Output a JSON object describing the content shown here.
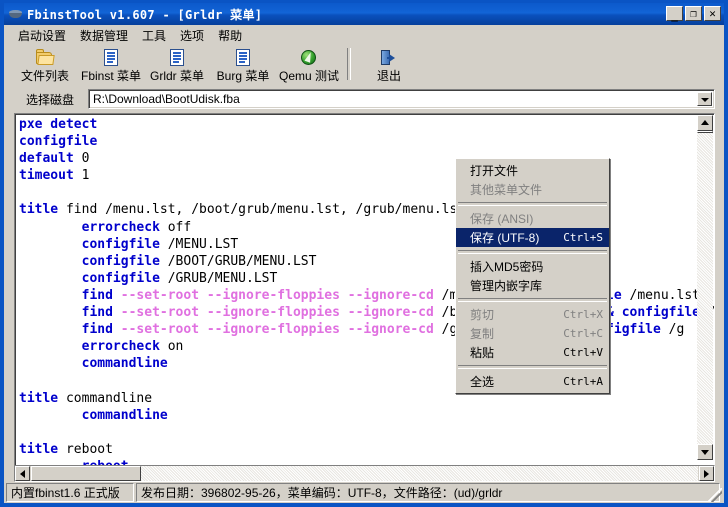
{
  "window": {
    "title": "FbinstTool v1.607 - [Grldr 菜单]",
    "icon": "disk-icon",
    "buttons": {
      "minimize": "_",
      "maximize": "❐",
      "close": "✕"
    },
    "accent": "#0a54c4"
  },
  "menubar": {
    "items": [
      {
        "label": "启动设置"
      },
      {
        "label": "数据管理"
      },
      {
        "label": "工具"
      },
      {
        "label": "选项"
      },
      {
        "label": "帮助"
      }
    ]
  },
  "toolbar": {
    "items": [
      {
        "label": "文件列表",
        "icon": "folder-icon"
      },
      {
        "label": "Fbinst 菜单",
        "icon": "document-list-icon"
      },
      {
        "label": "Grldr 菜单",
        "icon": "document-list-icon"
      },
      {
        "label": "Burg 菜单",
        "icon": "document-list-icon"
      },
      {
        "label": "Qemu 测试",
        "icon": "qemu-icon"
      },
      {
        "label": "退出",
        "icon": "exit-icon"
      }
    ]
  },
  "diskbar": {
    "label": "选择磁盘",
    "value": "R:\\Download\\BootUdisk.fba",
    "placeholder": "R:\\Download\\BootUdisk.fba"
  },
  "editor": {
    "lines": [
      [
        {
          "t": "pxe detect",
          "c": "kw"
        }
      ],
      [
        {
          "t": "configfile",
          "c": "kw"
        }
      ],
      [
        {
          "t": "default",
          "c": "kw"
        },
        {
          "t": " 0",
          "c": "pl"
        }
      ],
      [
        {
          "t": "timeout",
          "c": "kw"
        },
        {
          "t": " 1",
          "c": "pl"
        }
      ],
      [
        {
          "t": "",
          "c": "pl"
        }
      ],
      [
        {
          "t": "title",
          "c": "kw"
        },
        {
          "t": " find /menu.lst, /boot/grub/menu.lst, /grub/menu.lst",
          "c": "pl"
        }
      ],
      [
        {
          "t": "        ",
          "c": "pl"
        },
        {
          "t": "errorcheck",
          "c": "kw"
        },
        {
          "t": " off",
          "c": "pl"
        }
      ],
      [
        {
          "t": "        ",
          "c": "pl"
        },
        {
          "t": "configfile",
          "c": "kw"
        },
        {
          "t": " /MENU.LST",
          "c": "pl"
        }
      ],
      [
        {
          "t": "        ",
          "c": "pl"
        },
        {
          "t": "configfile",
          "c": "kw"
        },
        {
          "t": " /BOOT/GRUB/MENU.LST",
          "c": "pl"
        }
      ],
      [
        {
          "t": "        ",
          "c": "pl"
        },
        {
          "t": "configfile",
          "c": "kw"
        },
        {
          "t": " /GRUB/MENU.LST",
          "c": "pl"
        }
      ],
      [
        {
          "t": "        ",
          "c": "pl"
        },
        {
          "t": "find",
          "c": "kw"
        },
        {
          "t": " --set-root --ignore-floppies --ignore-cd ",
          "c": "op"
        },
        {
          "t": "/menu.lst && ",
          "c": "pl"
        },
        {
          "t": "configfile",
          "c": "kw"
        },
        {
          "t": " /menu.lst",
          "c": "pl"
        }
      ],
      [
        {
          "t": "        ",
          "c": "pl"
        },
        {
          "t": "find",
          "c": "kw"
        },
        {
          "t": " --set-root --ignore-floppies --ignore-cd ",
          "c": "op"
        },
        {
          "t": "/boot/grub/menu.lst ",
          "c": "pl"
        },
        {
          "t": "&&",
          "c": "kw"
        },
        {
          "t": " ",
          "c": "pl"
        },
        {
          "t": "configfile",
          "c": "kw"
        },
        {
          "t": " /b",
          "c": "pl"
        }
      ],
      [
        {
          "t": "        ",
          "c": "pl"
        },
        {
          "t": "find",
          "c": "kw"
        },
        {
          "t": " --set-root --ignore-floppies --ignore-cd ",
          "c": "op"
        },
        {
          "t": "/grub/menu.lst && ",
          "c": "pl"
        },
        {
          "t": "configfile",
          "c": "kw"
        },
        {
          "t": " /g",
          "c": "pl"
        }
      ],
      [
        {
          "t": "        ",
          "c": "pl"
        },
        {
          "t": "errorcheck",
          "c": "kw"
        },
        {
          "t": " on",
          "c": "pl"
        }
      ],
      [
        {
          "t": "        ",
          "c": "pl"
        },
        {
          "t": "commandline",
          "c": "kw"
        }
      ],
      [
        {
          "t": "",
          "c": "pl"
        }
      ],
      [
        {
          "t": "title",
          "c": "kw"
        },
        {
          "t": " commandline",
          "c": "pl"
        }
      ],
      [
        {
          "t": "        ",
          "c": "pl"
        },
        {
          "t": "commandline",
          "c": "kw"
        }
      ],
      [
        {
          "t": "",
          "c": "pl"
        }
      ],
      [
        {
          "t": "title",
          "c": "kw"
        },
        {
          "t": " reboot",
          "c": "pl"
        }
      ],
      [
        {
          "t": "        ",
          "c": "pl"
        },
        {
          "t": "reboot",
          "c": "kw"
        }
      ]
    ]
  },
  "context_menu": {
    "items": [
      {
        "label": "打开文件",
        "accel": "",
        "state": "normal"
      },
      {
        "label": "其他菜单文件",
        "accel": "",
        "state": "disabled"
      },
      {
        "separator": true
      },
      {
        "label": "保存 (ANSI)",
        "accel": "",
        "state": "disabled"
      },
      {
        "label": "保存 (UTF-8)",
        "accel": "Ctrl+S",
        "state": "selected"
      },
      {
        "separator": true
      },
      {
        "label": "插入MD5密码",
        "accel": "",
        "state": "normal"
      },
      {
        "label": "管理内嵌字库",
        "accel": "",
        "state": "normal"
      },
      {
        "separator": true
      },
      {
        "label": "剪切",
        "accel": "Ctrl+X",
        "state": "disabled"
      },
      {
        "label": "复制",
        "accel": "Ctrl+C",
        "state": "disabled"
      },
      {
        "label": "粘贴",
        "accel": "Ctrl+V",
        "state": "normal"
      },
      {
        "separator": true
      },
      {
        "label": "全选",
        "accel": "Ctrl+A",
        "state": "normal"
      }
    ],
    "highlight_color": "#0a246a"
  },
  "statusbar": {
    "left": "内置fbinst1.6 正式版",
    "right": "发布日期：396802-95-26，菜单编码：UTF-8，文件路径：(ud)/grldr"
  }
}
